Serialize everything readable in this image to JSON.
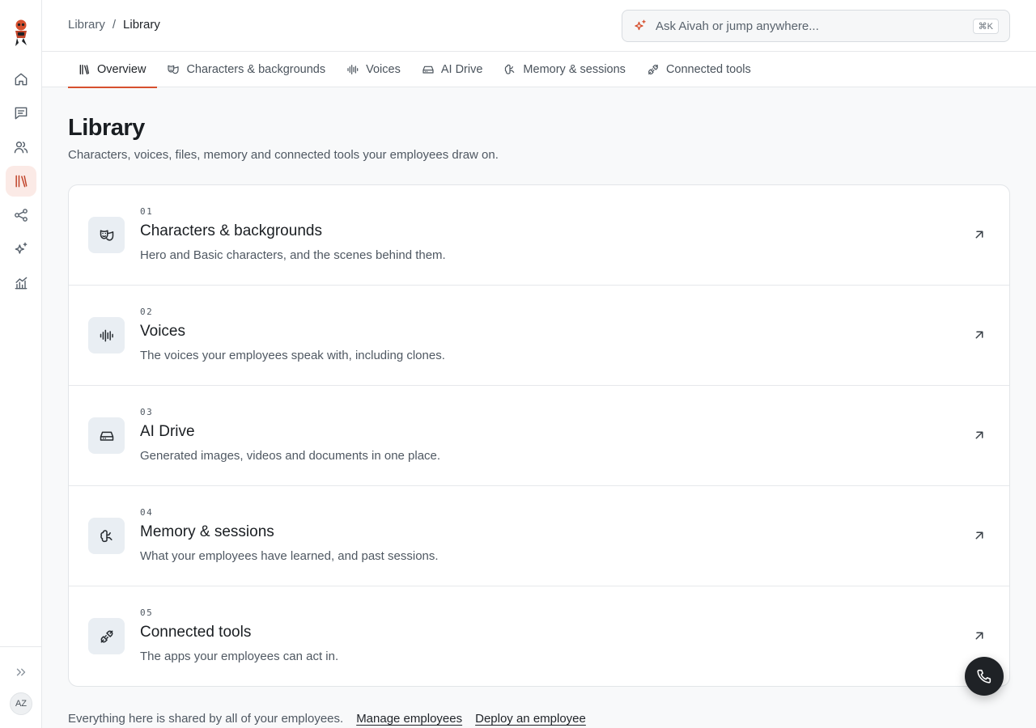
{
  "sidebar": {
    "logo": "robot-mascot-logo",
    "items": [
      {
        "icon": "home-icon",
        "active": false
      },
      {
        "icon": "chat-icon",
        "active": false
      },
      {
        "icon": "users-icon",
        "active": false
      },
      {
        "icon": "library-icon",
        "active": true
      },
      {
        "icon": "share-icon",
        "active": false
      },
      {
        "icon": "sparkles-icon",
        "active": false
      },
      {
        "icon": "analytics-icon",
        "active": false
      }
    ],
    "expand_icon": "chevrons-right-icon",
    "avatar_initials": "AZ"
  },
  "header": {
    "breadcrumb": {
      "parent": "Library",
      "separator": "/",
      "current": "Library"
    },
    "search": {
      "placeholder": "Ask Aivah or jump anywhere...",
      "shortcut": "⌘K",
      "icon": "sparkle-icon"
    }
  },
  "tabs": [
    {
      "label": "Overview",
      "icon": "library-icon",
      "active": true
    },
    {
      "label": "Characters & backgrounds",
      "icon": "masks-icon",
      "active": false
    },
    {
      "label": "Voices",
      "icon": "waveform-icon",
      "active": false
    },
    {
      "label": "AI Drive",
      "icon": "drive-icon",
      "active": false
    },
    {
      "label": "Memory & sessions",
      "icon": "brain-icon",
      "active": false
    },
    {
      "label": "Connected tools",
      "icon": "plug-icon",
      "active": false
    }
  ],
  "main": {
    "title": "Library",
    "subtitle": "Characters, voices, files, memory and connected tools your employees draw on.",
    "cards": [
      {
        "number": "01",
        "title": "Characters & backgrounds",
        "description": "Hero and Basic characters, and the scenes behind them.",
        "icon": "masks-icon"
      },
      {
        "number": "02",
        "title": "Voices",
        "description": "The voices your employees speak with, including clones.",
        "icon": "waveform-icon"
      },
      {
        "number": "03",
        "title": "AI Drive",
        "description": "Generated images, videos and documents in one place.",
        "icon": "drive-icon"
      },
      {
        "number": "04",
        "title": "Memory & sessions",
        "description": "What your employees have learned, and past sessions.",
        "icon": "brain-icon"
      },
      {
        "number": "05",
        "title": "Connected tools",
        "description": "The apps your employees can act in.",
        "icon": "plug-icon"
      }
    ]
  },
  "footer": {
    "text": "Everything here is shared by all of your employees.",
    "links": [
      "Manage employees",
      "Deploy an employee"
    ]
  },
  "fab": {
    "icon": "phone-icon"
  },
  "colors": {
    "accent": "#d6502f",
    "active_nav_bg": "#fbeae6",
    "icon_tile_bg": "#e9eef3"
  }
}
